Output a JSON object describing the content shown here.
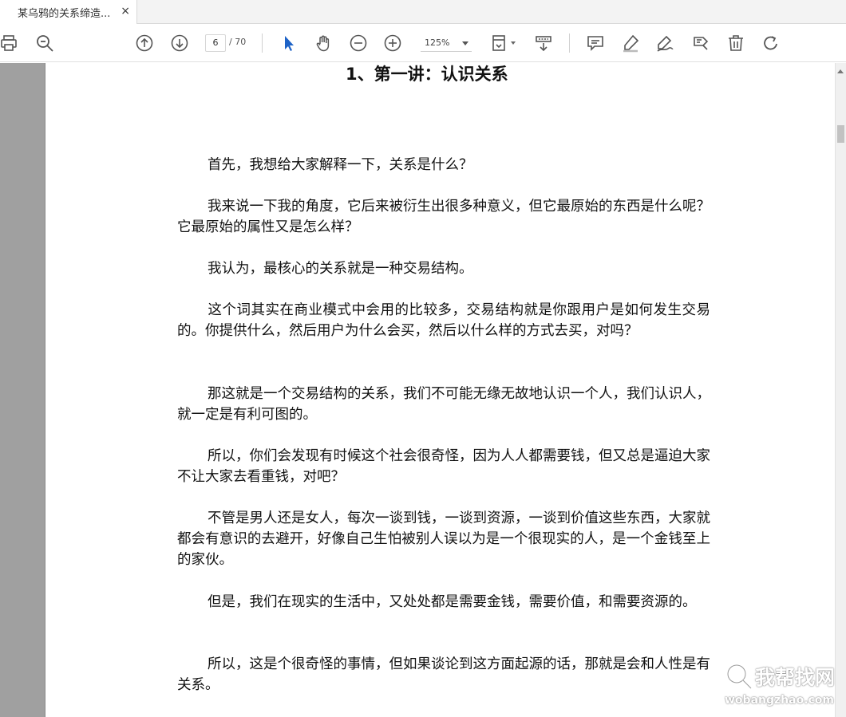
{
  "tab": {
    "title": "某乌鸦的关系缔造...",
    "close": "×"
  },
  "toolbar": {
    "page_current": "6",
    "page_total": "/ 70",
    "zoom": "125%"
  },
  "icons": [
    "print-icon",
    "search-icon",
    "page-up-icon",
    "page-down-icon",
    "select-cursor-icon",
    "hand-icon",
    "zoom-out-icon",
    "zoom-in-icon",
    "fit-page-icon",
    "scroll-mode-icon",
    "comment-icon",
    "highlight-icon",
    "draw-sign-icon",
    "tag-edit-icon",
    "delete-icon",
    "rotate-icon"
  ],
  "document": {
    "title": "1、第一讲：认识关系",
    "paragraphs": [
      "首先，我想给大家解释一下，关系是什么？",
      "我来说一下我的角度，它后来被衍生出很多种意义，但它最原始的东西是什么呢？它最原始的属性又是怎么样？",
      "我认为，最核心的关系就是一种交易结构。",
      "这个词其实在商业模式中会用的比较多，交易结构就是你跟用户是如何发生交易的。你提供什么，然后用户为什么会买，然后以什么样的方式去买，对吗？",
      "那这就是一个交易结构的关系，我们不可能无缘无故地认识一个人，我们认识人，就一定是有利可图的。",
      "所以，你们会发现有时候这个社会很奇怪，因为人人都需要钱，但又总是逼迫大家不让大家去看重钱，对吧？",
      "不管是男人还是女人，每次一谈到钱，一谈到资源，一谈到价值这些东西，大家就都会有意识的去避开，好像自己生怕被别人误以为是一个很现实的人，是一个金钱至上的家伙。",
      "但是，我们在现实的生活中，又处处都是需要金钱，需要价值，和需要资源的。",
      "所以，这是个很奇怪的事情，但如果谈论到这方面起源的话，那就是会和人性是有关系。"
    ]
  },
  "watermark": {
    "name": "我帮找网",
    "url": "wobangzhao.com"
  }
}
